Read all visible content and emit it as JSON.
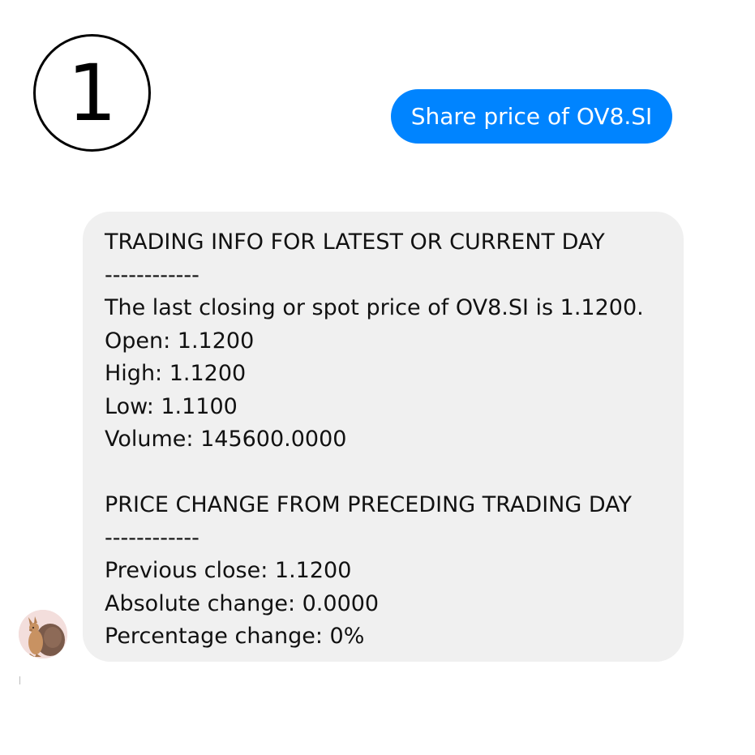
{
  "step": {
    "number": "1"
  },
  "conversation": {
    "user_message": "Share price of OV8.SI",
    "bot_reply": {
      "lines": [
        "TRADING INFO FOR LATEST OR CURRENT DAY",
        "------------",
        "The last closing or spot price of OV8.SI is 1.1200.",
        "Open: 1.1200",
        "High: 1.1200",
        "Low: 1.1100",
        "Volume: 145600.0000",
        "",
        "PRICE CHANGE FROM PRECEDING TRADING DAY",
        "------------",
        "Previous close: 1.1200",
        "Absolute change: 0.0000",
        "Percentage change: 0%"
      ]
    }
  },
  "avatar": {
    "icon": "kangaroo-avatar-icon"
  },
  "colors": {
    "outgoing_bubble": "#0084ff",
    "incoming_bubble": "#f0f0f0",
    "avatar_background": "#f3dedc"
  }
}
